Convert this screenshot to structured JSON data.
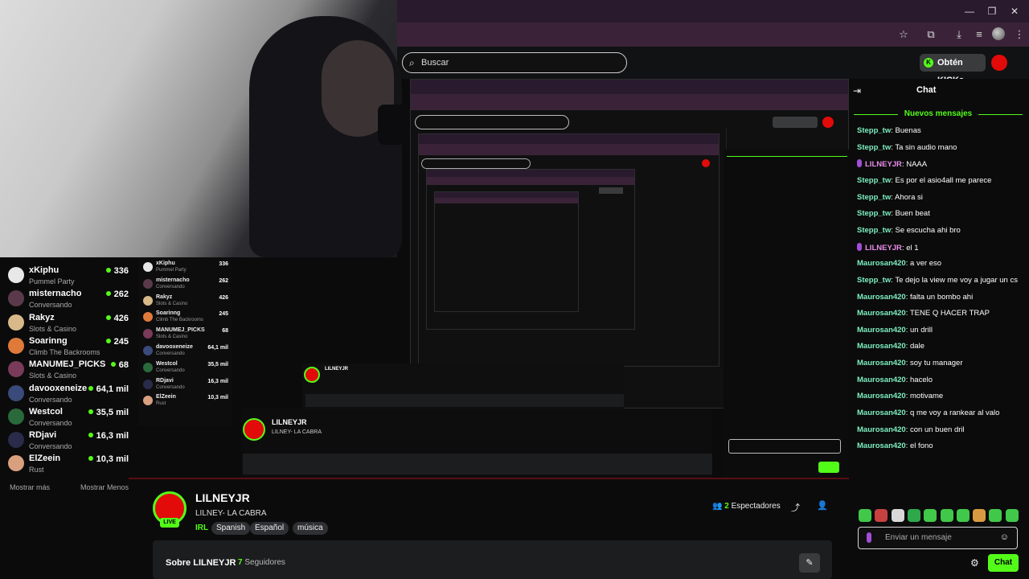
{
  "browser": {
    "window_controls": [
      "—",
      "❐",
      "✕"
    ],
    "toolbar_icons": [
      "☆",
      "⧉",
      "⤓",
      "≡",
      "⋮"
    ]
  },
  "header": {
    "search_placeholder": "Buscar",
    "kicks_button": "Obtén KICKs"
  },
  "sidebar": {
    "items": [
      {
        "name": "xKiphu",
        "category": "Pummel Party",
        "viewers": "336",
        "color": "#e8e8e8"
      },
      {
        "name": "misternacho",
        "category": "Conversando",
        "viewers": "262",
        "color": "#5a3a4a"
      },
      {
        "name": "Rakyz",
        "category": "Slots & Casino",
        "viewers": "426",
        "color": "#d8b98a"
      },
      {
        "name": "Soarinng",
        "category": "Climb The Backrooms",
        "viewers": "245",
        "color": "#e07a3a"
      },
      {
        "name": "MANUMEJ_PICKS",
        "category": "Slots & Casino",
        "viewers": "68",
        "color": "#7a3a5a"
      },
      {
        "name": "davooxeneize",
        "category": "Conversando",
        "viewers": "64,1 mil",
        "color": "#3a4a7a"
      },
      {
        "name": "Westcol",
        "category": "Conversando",
        "viewers": "35,5 mil",
        "color": "#2a6a3a"
      },
      {
        "name": "RDjavi",
        "category": "Conversando",
        "viewers": "16,3 mil",
        "color": "#2a2a4a"
      },
      {
        "name": "ElZeein",
        "category": "Rust",
        "viewers": "10,3 mil",
        "color": "#d9a080"
      }
    ],
    "show_more": "Mostrar más",
    "show_less": "Mostrar Menos"
  },
  "stream": {
    "live_badge": "LIVE",
    "channel": "LILNEYJR",
    "title": "LILNEY- LA CABRA",
    "category": "IRL",
    "tags": [
      "Spanish",
      "Español",
      "música"
    ],
    "viewers_count": "2",
    "viewers_label": "Espectadores",
    "about_label": "Sobre LILNEYJR",
    "followers_count": "7",
    "followers_label": "Seguidores"
  },
  "chat": {
    "title": "Chat",
    "new_messages": "Nuevos mensajes",
    "messages": [
      {
        "user": "Stepp_tw",
        "text": "Buenas",
        "sub": false
      },
      {
        "user": "Stepp_tw",
        "text": "Ta sin audio mano",
        "sub": false
      },
      {
        "user": "LILNEYJR",
        "text": "NAAA",
        "sub": true
      },
      {
        "user": "Stepp_tw",
        "text": "Es por el asio4all me parece",
        "sub": false
      },
      {
        "user": "Stepp_tw",
        "text": "Ahora si",
        "sub": false
      },
      {
        "user": "Stepp_tw",
        "text": "Buen beat",
        "sub": false
      },
      {
        "user": "Stepp_tw",
        "text": "Se escucha ahi bro",
        "sub": false
      },
      {
        "user": "LILNEYJR",
        "text": "el 1",
        "sub": true
      },
      {
        "user": "Maurosan420",
        "text": "a ver eso",
        "sub": false
      },
      {
        "user": "Stepp_tw",
        "text": "Te dejo la view me voy a jugar un cs",
        "sub": false
      },
      {
        "user": "Maurosan420",
        "text": "falta un bombo ahi",
        "sub": false
      },
      {
        "user": "Maurosan420",
        "text": "TENE Q HACER TRAP",
        "sub": false
      },
      {
        "user": "Maurosan420",
        "text": "un drill",
        "sub": false
      },
      {
        "user": "Maurosan420",
        "text": "dale",
        "sub": false
      },
      {
        "user": "Maurosan420",
        "text": "soy tu manager",
        "sub": false
      },
      {
        "user": "Maurosan420",
        "text": "hacelo",
        "sub": false
      },
      {
        "user": "Maurosan420",
        "text": "motivame",
        "sub": false
      },
      {
        "user": "Maurosan420",
        "text": "q me voy a rankear al valo",
        "sub": false
      },
      {
        "user": "Maurosan420",
        "text": "con un buen dril",
        "sub": false
      },
      {
        "user": "Maurosan420",
        "text": "el fono",
        "sub": false
      }
    ],
    "input_placeholder": "Enviar un mensaje",
    "send_button": "Chat"
  },
  "colors": {
    "accent": "#53fc18",
    "live_red": "#e30a0a",
    "username": "#7ef0c0",
    "sub_user": "#e98de9"
  }
}
